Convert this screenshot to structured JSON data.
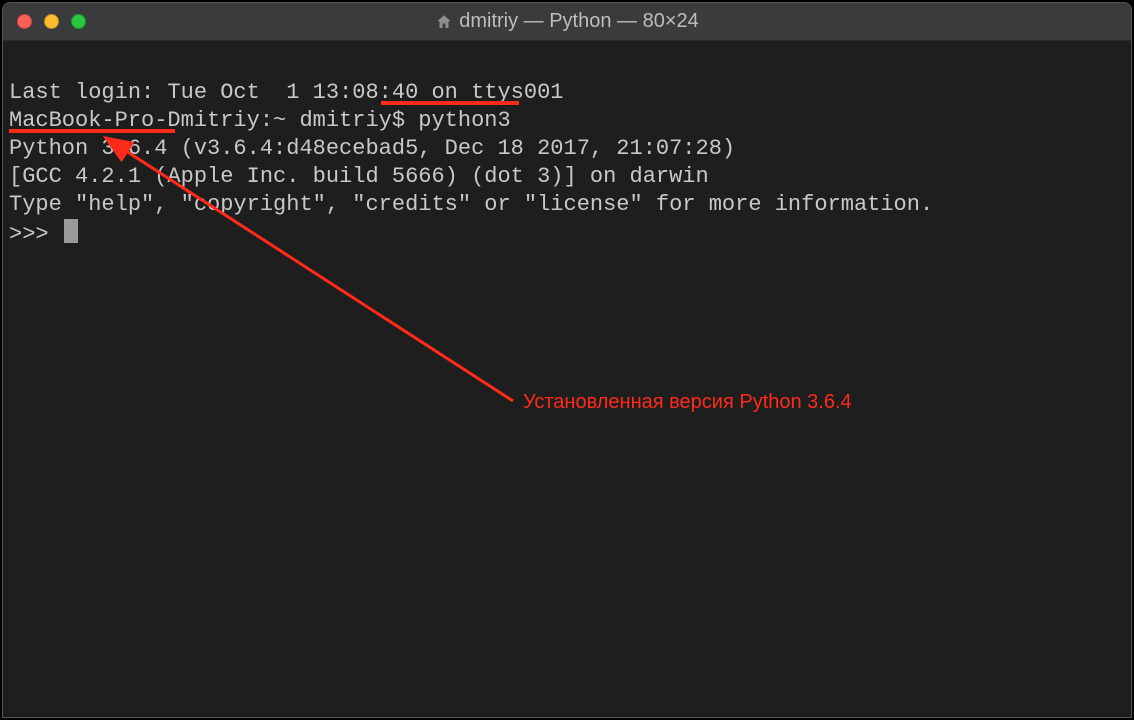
{
  "window": {
    "title": "dmitriy — Python — 80×24"
  },
  "terminal": {
    "lines": {
      "l0": "Last login: Tue Oct  1 13:08:40 on ttys001",
      "l1_prompt": "MacBook-Pro-Dmitriy:~ dmitriy$ ",
      "l1_cmd": "python3",
      "l2": "Python 3.6.4 (v3.6.4:d48ecebad5, Dec 18 2017, 21:07:28) ",
      "l3": "[GCC 4.2.1 (Apple Inc. build 5666) (dot 3)] on darwin",
      "l4": "Type \"help\", \"copyright\", \"credits\" or \"license\" for more information.",
      "l5_prompt": ">>> "
    }
  },
  "annotation": {
    "label": "Установленная версия Python 3.6.4"
  },
  "colors": {
    "annotation": "#ff2a1a"
  }
}
